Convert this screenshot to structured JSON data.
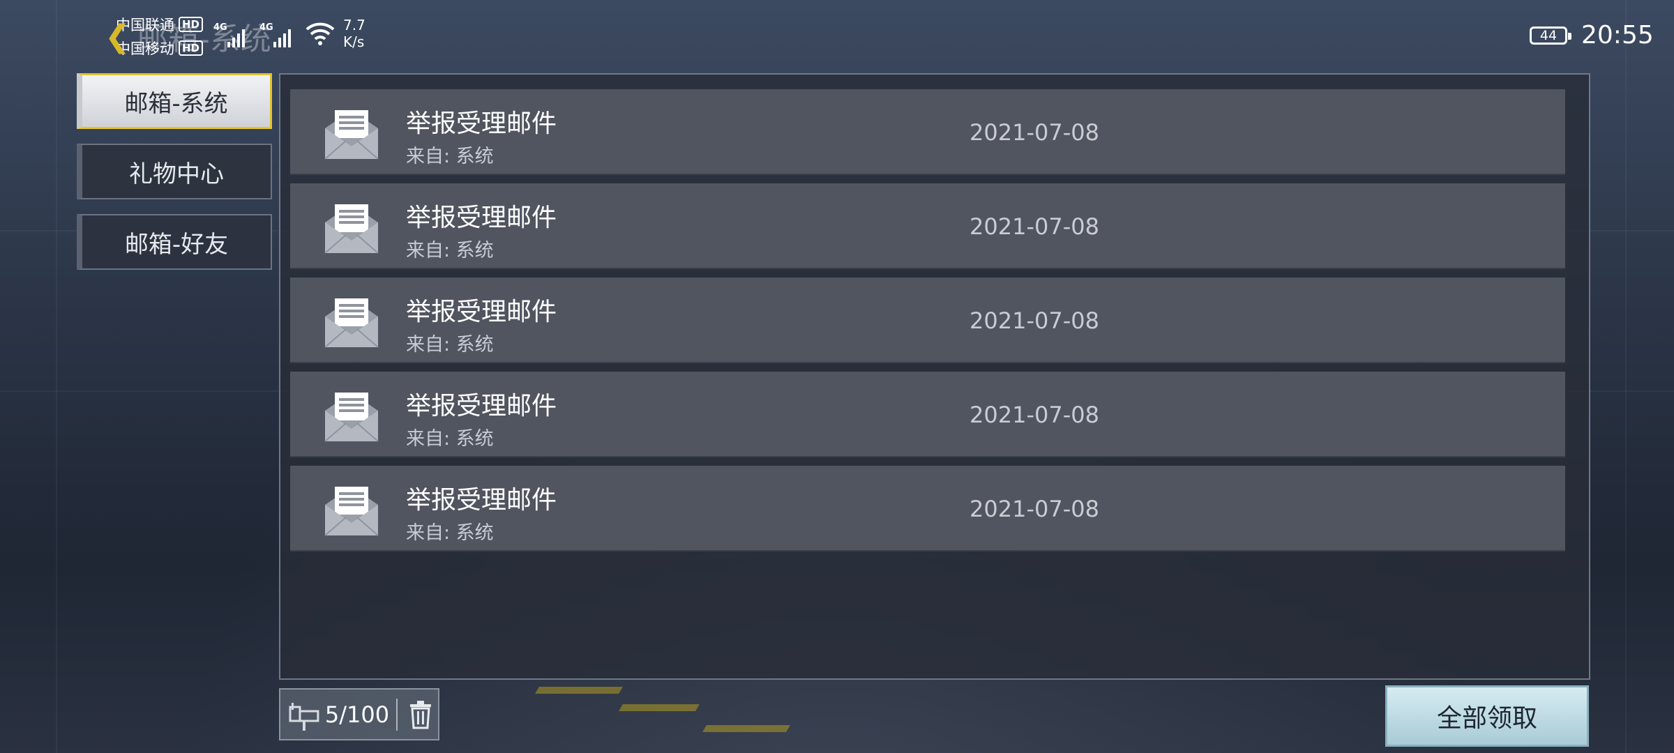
{
  "status_bar": {
    "carrier1": "中国联通",
    "carrier2": "中国移动",
    "hd": "HD",
    "net": "4G",
    "speed_value": "7.7",
    "speed_unit": "K/s",
    "battery": "44",
    "time": "20:55"
  },
  "header": {
    "title": "邮箱-系统"
  },
  "sidebar": {
    "tabs": [
      {
        "label": "邮箱-系统",
        "active": true
      },
      {
        "label": "礼物中心",
        "active": false
      },
      {
        "label": "邮箱-好友",
        "active": false
      }
    ]
  },
  "mails": [
    {
      "title": "举报受理邮件",
      "from": "来自: 系统",
      "date": "2021-07-08"
    },
    {
      "title": "举报受理邮件",
      "from": "来自: 系统",
      "date": "2021-07-08"
    },
    {
      "title": "举报受理邮件",
      "from": "来自: 系统",
      "date": "2021-07-08"
    },
    {
      "title": "举报受理邮件",
      "from": "来自: 系统",
      "date": "2021-07-08"
    },
    {
      "title": "举报受理邮件",
      "from": "来自: 系统",
      "date": "2021-07-08"
    }
  ],
  "footer": {
    "count": "5/100",
    "claim_all": "全部领取"
  },
  "colors": {
    "accent": "#e3c52a",
    "claim_button": "#bfdde6"
  },
  "icons": [
    "back-arrow-icon",
    "envelope-open-icon",
    "mailbox-icon",
    "trash-icon",
    "wifi-icon",
    "signal-icon",
    "battery-icon"
  ]
}
